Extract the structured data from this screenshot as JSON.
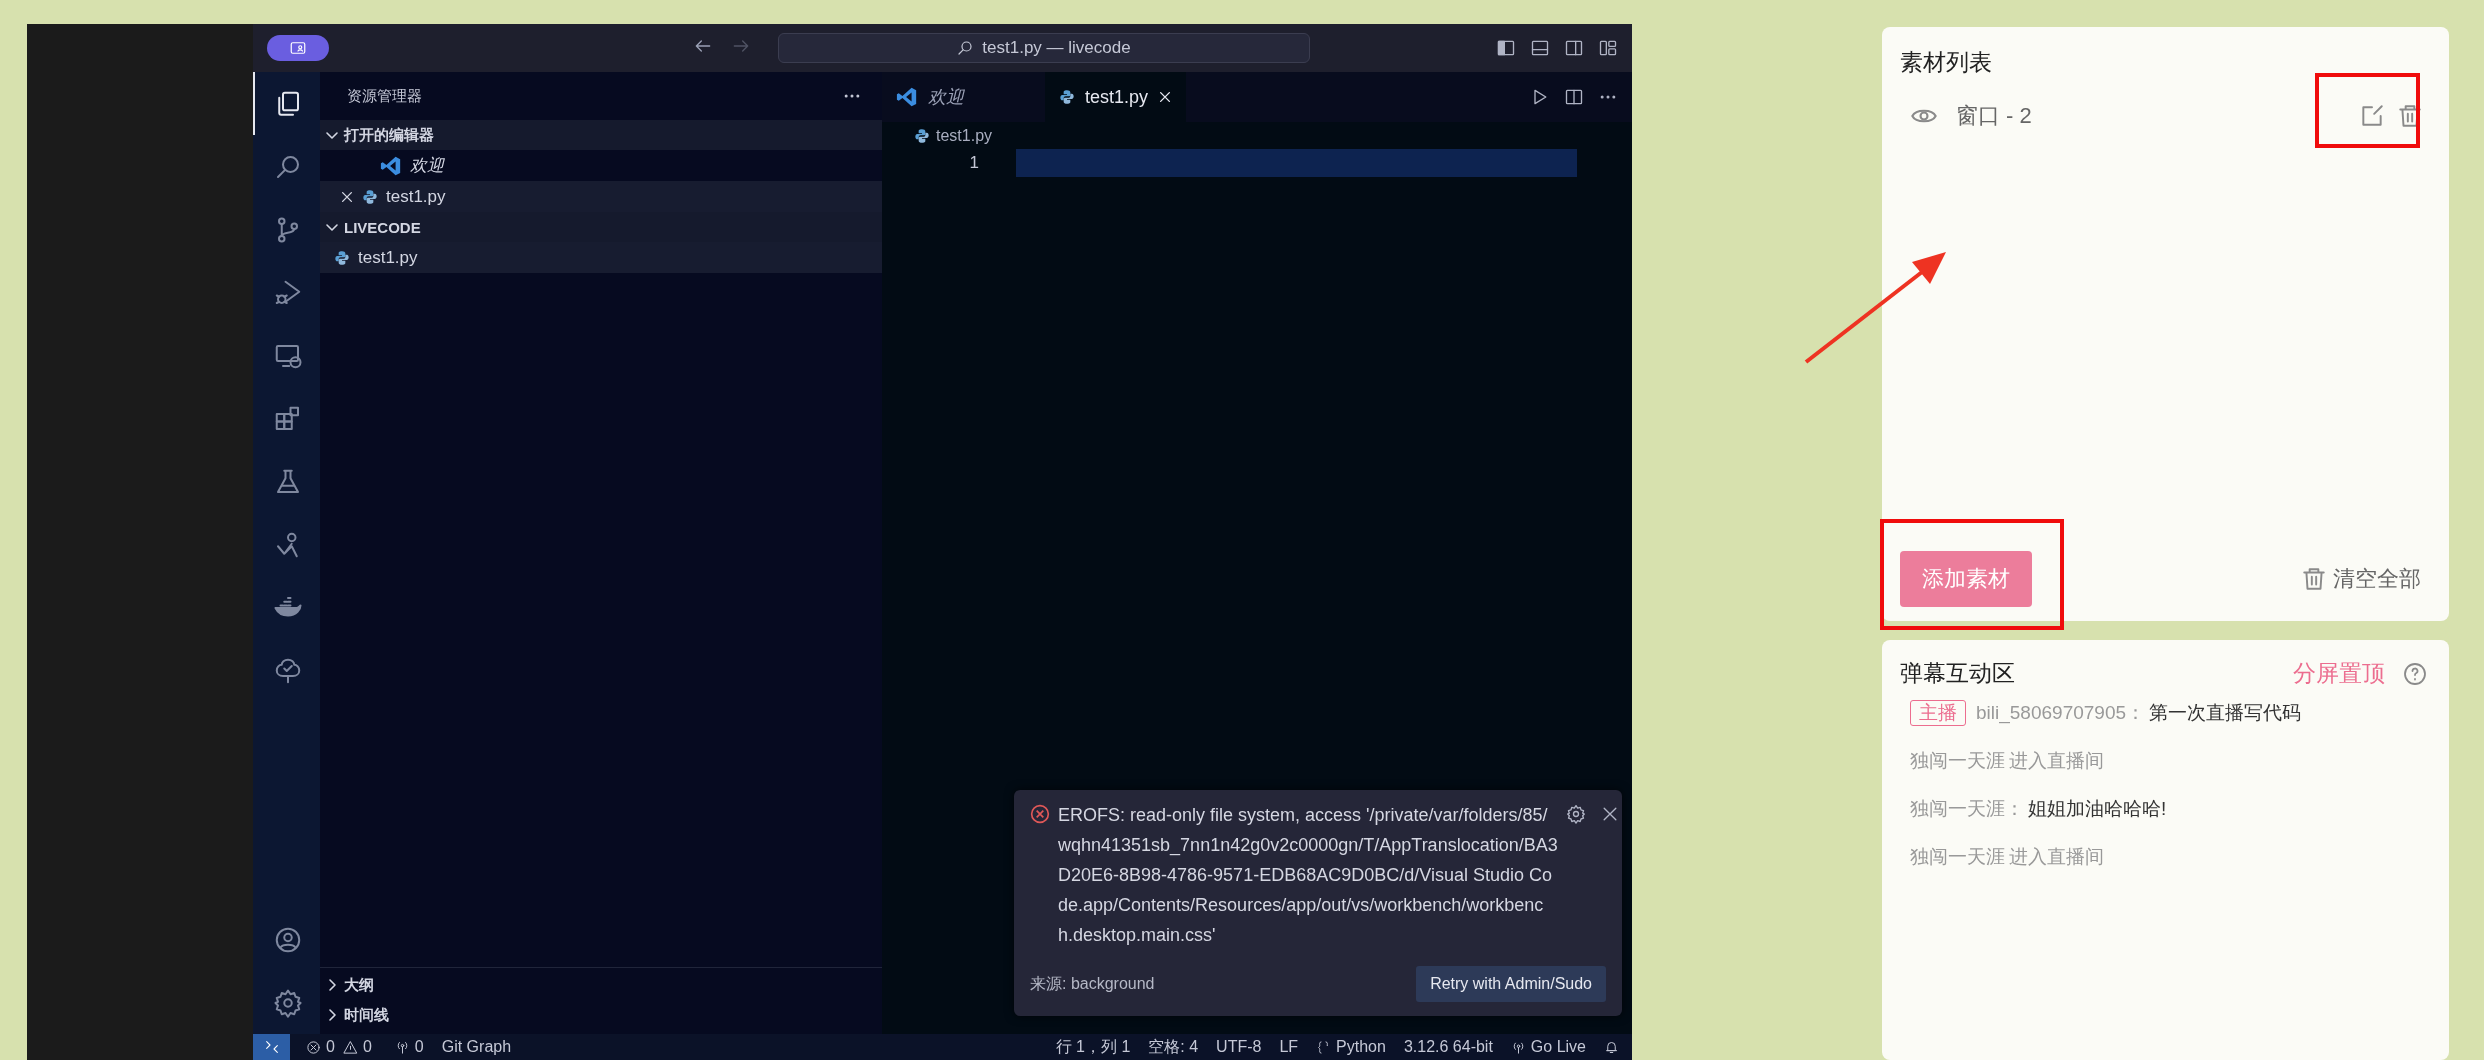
{
  "titlebar": {
    "search": "test1.py — livecode"
  },
  "activity_bar": {
    "items": [
      {
        "kind": "files",
        "selected": true
      },
      {
        "kind": "search",
        "selected": false
      },
      {
        "kind": "git",
        "selected": false
      },
      {
        "kind": "debug",
        "selected": false
      },
      {
        "kind": "remote",
        "selected": false
      },
      {
        "kind": "extensions",
        "selected": false
      },
      {
        "kind": "testing",
        "selected": false
      },
      {
        "kind": "live",
        "selected": false
      },
      {
        "kind": "docker",
        "selected": false
      },
      {
        "kind": "tree",
        "selected": false
      }
    ],
    "bottom": [
      {
        "kind": "account"
      },
      {
        "kind": "settings"
      }
    ]
  },
  "sidebar": {
    "title": "资源管理器",
    "sections": [
      {
        "title": "打开的编辑器",
        "expanded": true,
        "items": [
          {
            "label": "欢迎",
            "kind": "welcome",
            "selected": false,
            "closable": false
          },
          {
            "label": "test1.py",
            "kind": "python",
            "selected": true,
            "closable": true
          }
        ]
      },
      {
        "title": "LIVECODE",
        "expanded": true,
        "items": [
          {
            "label": "test1.py",
            "kind": "python",
            "selected": true,
            "closable": false
          }
        ]
      }
    ],
    "bottom_sections": [
      {
        "title": "大纲",
        "expanded": false
      },
      {
        "title": "时间线",
        "expanded": false
      }
    ]
  },
  "editor": {
    "tabs": [
      {
        "label": "欢迎",
        "kind": "welcome",
        "selected": false
      },
      {
        "label": "test1.py",
        "kind": "python",
        "selected": true
      }
    ],
    "breadcrumb": "test1.py",
    "line_numbers": [
      "1"
    ]
  },
  "notification": {
    "message": "EROFS: read-only file system, access '/private/var/folders/85/wqhn41351sb_7nn1n42g0v2c0000gn/T/AppTranslocation/BA3D20E6-8B98-4786-9571-EDB68AC9D0BC/d/Visual Studio Code.app/Contents/Resources/app/out/vs/workbench/workbench.desktop.main.css'",
    "source": "来源: background",
    "button": "Retry with Admin/Sudo"
  },
  "status_bar": {
    "left": [
      {
        "kind": "errors",
        "text": "0"
      },
      {
        "kind": "warnings",
        "text": "0"
      },
      {
        "kind": "ports",
        "text": "0"
      },
      {
        "kind": "plain",
        "text": "Git Graph"
      }
    ],
    "right": [
      {
        "kind": "plain",
        "text": "行 1，列 1"
      },
      {
        "kind": "plain",
        "text": "空格: 4"
      },
      {
        "kind": "plain",
        "text": "UTF-8"
      },
      {
        "kind": "plain",
        "text": "LF"
      },
      {
        "kind": "braces",
        "text": "Python"
      },
      {
        "kind": "plain",
        "text": "3.12.6 64-bit"
      },
      {
        "kind": "broadcast",
        "text": "Go Live"
      },
      {
        "kind": "bell"
      }
    ]
  },
  "materials": {
    "title": "素材列表",
    "items": [
      {
        "name": "窗口 - 2"
      }
    ],
    "add_button": "添加素材",
    "clear_button": "清空全部"
  },
  "danmaku": {
    "title": "弹幕互动区",
    "pin_link": "分屏置顶",
    "messages": [
      {
        "kind": "chat",
        "badge": "主播",
        "user": "bili_58069707905：",
        "text": "第一次直播写代码"
      },
      {
        "kind": "enter",
        "user": "独闯一天涯",
        "text": "进入直播间"
      },
      {
        "kind": "chat",
        "user": "独闯一天涯：",
        "text": "姐姐加油哈哈哈!"
      },
      {
        "kind": "enter",
        "user": "独闯一天涯",
        "text": "进入直播间"
      }
    ]
  }
}
